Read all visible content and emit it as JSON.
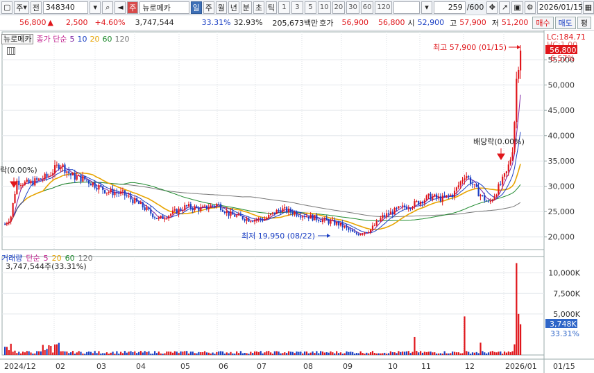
{
  "toolbar": {
    "market": "주",
    "market_sub": "전",
    "code": "348340",
    "name": "뉴로메카",
    "periods": [
      "일",
      "주",
      "월",
      "년",
      "분",
      "초",
      "틱"
    ],
    "selected_period": "일",
    "intervals": [
      "1",
      "3",
      "5",
      "10",
      "20",
      "30",
      "60",
      "120"
    ],
    "count": "259",
    "total": "/600",
    "date": "2026/01/15"
  },
  "quote": {
    "price": "56,800",
    "change": "2,500",
    "change_pct": "+4.60%",
    "volume": "3,747,544",
    "turnover_pct": "33.31%",
    "ratio": "32.93%",
    "amount": "205,673백만",
    "bid_label": "호가",
    "bid1": "56,900",
    "bid2": "56,800",
    "open_label": "시",
    "open": "52,900",
    "high_label": "고",
    "high": "57,900",
    "low_label": "저",
    "low": "51,200",
    "buy": "매수",
    "sell": "매도",
    "eval": "평"
  },
  "main_legend": {
    "name": "뉴로메카",
    "label": "종가 단순",
    "ma": [
      "5",
      "10",
      "20",
      "60",
      "120"
    ]
  },
  "vol_legend": {
    "label": "거래량",
    "sub": "단순",
    "ma": [
      "5",
      "20",
      "60",
      "120"
    ],
    "value": "3,747,544주(33.31%)"
  },
  "annotations": {
    "high": "최고 57,900 (01/15)",
    "low": "최저 19,950 (08/22)",
    "dividend": "배당락(0.00%)",
    "dividend_left": "락(0.00%)"
  },
  "right_axis": {
    "lc": "LC:184.71",
    "hc": "HC:1.00",
    "price_tag": "56,800",
    "pct_tag": "6.57%",
    "vol_tag": "3,748K",
    "vol_pct": "33.31%"
  },
  "colors": {
    "up": "#e0161b",
    "down": "#1a3fc4",
    "ma5": "#7a1fa2",
    "ma10": "#1a3fc4",
    "ma20": "#e8a400",
    "ma60": "#1f8a2e",
    "ma120": "#777777"
  },
  "chart_data": {
    "type": "candlestick",
    "x_labels": [
      "2024/12",
      "02",
      "03",
      "04",
      "05",
      "06",
      "07",
      "08",
      "09",
      "10",
      "11",
      "12",
      "2026/01",
      "01/15"
    ],
    "y_ticks": [
      "55,000",
      "50,000",
      "45,000",
      "40,000",
      "35,000",
      "30,000",
      "25,000",
      "20,000"
    ],
    "y_range": [
      17500,
      60500
    ],
    "vol_ticks": [
      "10,000K",
      "7,500K",
      "5,000K"
    ],
    "vol_range": [
      0,
      12000
    ],
    "monthly_close": [
      {
        "m": "2024/12",
        "close": 23500
      },
      {
        "m": "01",
        "close": 31000
      },
      {
        "m": "02",
        "close": 33500
      },
      {
        "m": "03",
        "close": 28500
      },
      {
        "m": "04",
        "close": 24000
      },
      {
        "m": "05",
        "close": 25500
      },
      {
        "m": "06",
        "close": 23000
      },
      {
        "m": "07",
        "close": 24500
      },
      {
        "m": "08",
        "close": 20500
      },
      {
        "m": "09",
        "close": 26500
      },
      {
        "m": "10",
        "close": 28000
      },
      {
        "m": "11",
        "close": 27500
      },
      {
        "m": "12",
        "close": 33500
      },
      {
        "m": "2026/01",
        "close": 56800
      }
    ]
  }
}
